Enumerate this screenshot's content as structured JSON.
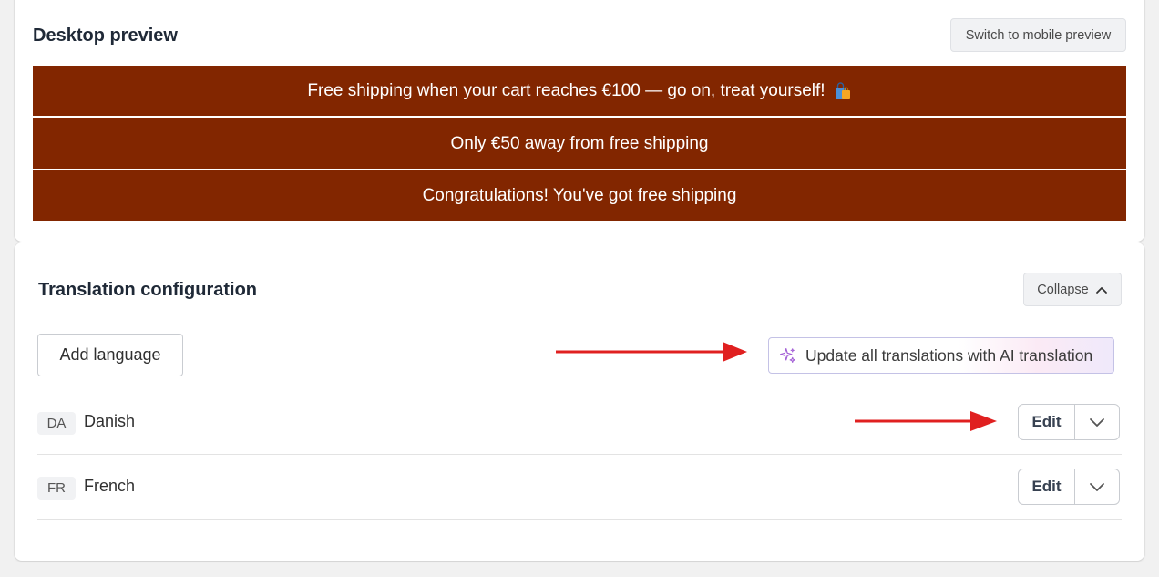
{
  "preview": {
    "title": "Desktop preview",
    "switch_button": "Switch to mobile preview",
    "banners": [
      {
        "text": "Free shipping when your cart reaches €100 — go on, treat yourself!",
        "icon": "shopping-bag-icon"
      },
      {
        "text": "Only €50 away from free shipping"
      },
      {
        "text": "Congratulations! You've got free shipping"
      }
    ],
    "banner_color": "#822600",
    "banner_text_color": "#ffffff"
  },
  "translation": {
    "title": "Translation configuration",
    "collapse_button": "Collapse",
    "add_language_button": "Add language",
    "ai_button": "Update all translations with AI translation",
    "ai_icon": "sparkles-icon",
    "languages": [
      {
        "code": "DA",
        "name": "Danish",
        "edit_label": "Edit"
      },
      {
        "code": "FR",
        "name": "French",
        "edit_label": "Edit"
      }
    ],
    "annotation_arrow_color": "#e02020"
  }
}
